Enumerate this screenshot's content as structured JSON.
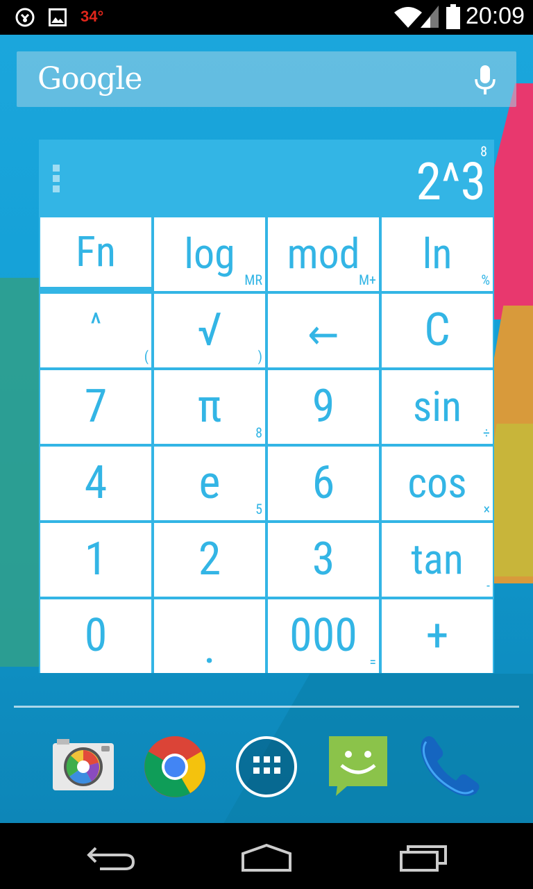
{
  "status_bar": {
    "time": "20:09",
    "temperature": "34°",
    "icons": [
      "sync-icon",
      "image-notification-icon",
      "wifi-icon",
      "signal-icon",
      "battery-icon"
    ]
  },
  "search_widget": {
    "logo": "Google",
    "mic_icon": "microphone-icon"
  },
  "calculator": {
    "result_preview": "8",
    "expression": "2^3",
    "menu_icon": "overflow-menu-icon",
    "accent_color": "#33b5e5",
    "keys": [
      {
        "id": "fn",
        "main": "Fn",
        "sub": ""
      },
      {
        "id": "log",
        "main": "log",
        "sub": "MR"
      },
      {
        "id": "mod",
        "main": "mod",
        "sub": "M+"
      },
      {
        "id": "ln",
        "main": "ln",
        "sub": "%"
      },
      {
        "id": "power",
        "main": "^",
        "sub": "("
      },
      {
        "id": "sqrt",
        "main": "√",
        "sub": ")"
      },
      {
        "id": "backspace",
        "main": "←",
        "sub": ""
      },
      {
        "id": "clear",
        "main": "C",
        "sub": ""
      },
      {
        "id": "seven",
        "main": "7",
        "sub": ""
      },
      {
        "id": "pi",
        "main": "π",
        "sub": "8"
      },
      {
        "id": "nine",
        "main": "9",
        "sub": ""
      },
      {
        "id": "sin",
        "main": "sin",
        "sub": "÷"
      },
      {
        "id": "four",
        "main": "4",
        "sub": ""
      },
      {
        "id": "e",
        "main": "e",
        "sub": "5"
      },
      {
        "id": "six",
        "main": "6",
        "sub": ""
      },
      {
        "id": "cos",
        "main": "cos",
        "sub": "×"
      },
      {
        "id": "one",
        "main": "1",
        "sub": ""
      },
      {
        "id": "two",
        "main": "2",
        "sub": ""
      },
      {
        "id": "three",
        "main": "3",
        "sub": ""
      },
      {
        "id": "tan",
        "main": "tan",
        "sub": "-"
      },
      {
        "id": "zero",
        "main": "0",
        "sub": ""
      },
      {
        "id": "decimal",
        "main": ".",
        "sub": ""
      },
      {
        "id": "triple-zero",
        "main": "000",
        "sub": "="
      },
      {
        "id": "plus",
        "main": "+",
        "sub": ""
      }
    ]
  },
  "dock": {
    "apps": [
      "camera-app-icon",
      "chrome-app-icon",
      "app-drawer-icon",
      "messaging-app-icon",
      "phone-app-icon"
    ]
  },
  "nav_bar": {
    "buttons": [
      "back-icon",
      "home-icon",
      "recents-icon"
    ]
  }
}
